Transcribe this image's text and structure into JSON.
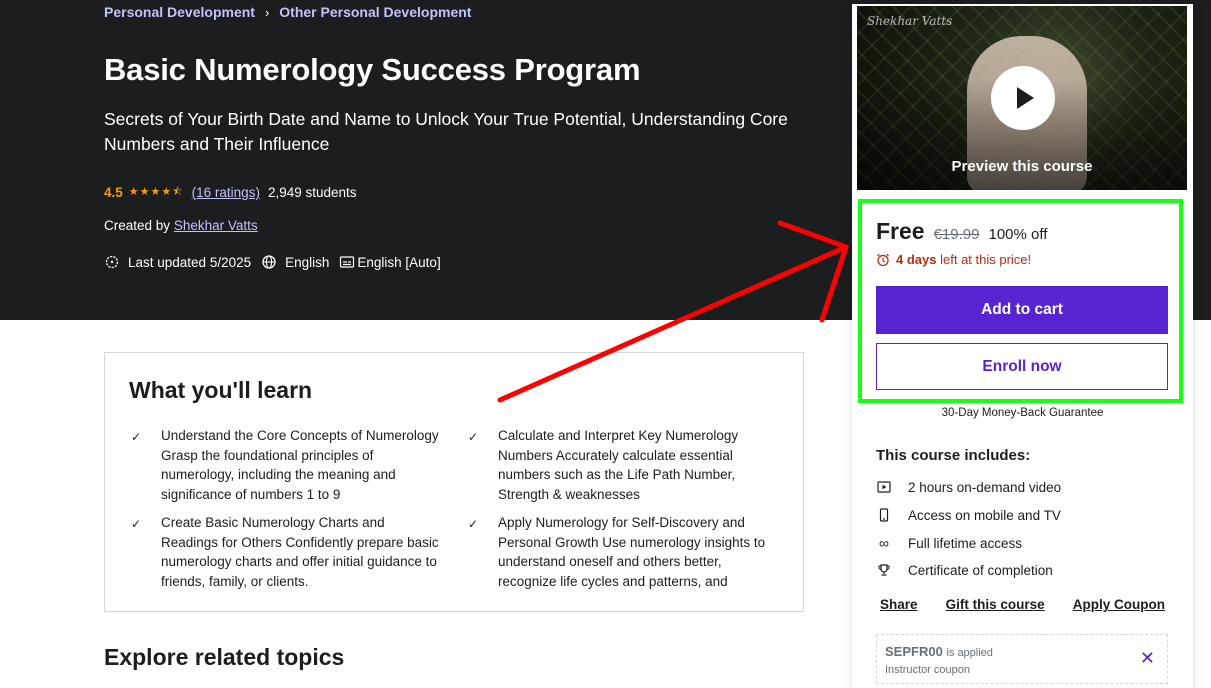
{
  "breadcrumb": {
    "items": [
      "Personal Development",
      "Other Personal Development"
    ],
    "separator": "›"
  },
  "course": {
    "title": "Basic Numerology Success Program",
    "subtitle": "Secrets of Your Birth Date and Name to Unlock Your True Potential, Understanding Core Numbers and Their Influence",
    "rating": "4.5",
    "rating_value": 4.5,
    "stars": "★★★★⯪",
    "ratings_count": "(16 ratings)",
    "students": "2,949 students",
    "created_by_label": "Created by",
    "instructor": "Shekhar Vatts",
    "last_updated": "Last updated 5/2025",
    "language": "English",
    "captions": "English [Auto]"
  },
  "learn": {
    "title": "What you'll learn",
    "items": [
      "Understand the Core Concepts of Numerology Grasp the foundational principles of numerology, including the meaning and significance of numbers 1 to 9",
      "Calculate and Interpret Key Numerology Numbers Accurately calculate essential numbers such as the Life Path Number, Strength & weaknesses",
      "Create Basic Numerology Charts and Readings for Others Confidently prepare basic numerology charts and offer initial guidance to friends, family, or clients.",
      "Apply Numerology for Self-Discovery and Personal Growth Use numerology insights to understand oneself and others better, recognize life cycles and patterns, and"
    ]
  },
  "related": {
    "title": "Explore related topics"
  },
  "sidebar": {
    "preview_label": "Preview this course",
    "preview_signature": "Shekhar Vatts",
    "price": "Free",
    "original_price": "€19.99",
    "discount": "100% off",
    "timer_bold": "4 days",
    "timer_rest": "left at this price!",
    "add_to_cart": "Add to cart",
    "enroll_now": "Enroll now",
    "guarantee": "30-Day Money-Back Guarantee",
    "includes_title": "This course includes:",
    "includes": [
      {
        "icon": "video-icon",
        "label": "2 hours on-demand video"
      },
      {
        "icon": "mobile-icon",
        "label": "Access on mobile and TV"
      },
      {
        "icon": "infinity-icon",
        "label": "Full lifetime access"
      },
      {
        "icon": "trophy-icon",
        "label": "Certificate of completion"
      }
    ],
    "share": "Share",
    "gift": "Gift this course",
    "apply_coupon": "Apply Coupon",
    "coupon_code": "SEPFR00",
    "coupon_applied": "is applied",
    "coupon_type": "Instructor coupon"
  },
  "colors": {
    "hero_bg": "#1c1d1f",
    "link_purple": "#c0c4fc",
    "star_orange": "#f69c08",
    "brand_purple": "#5624d0",
    "timer_red": "#b32d0f",
    "highlight_green": "#1aff1a",
    "arrow_red": "#ff0000"
  }
}
